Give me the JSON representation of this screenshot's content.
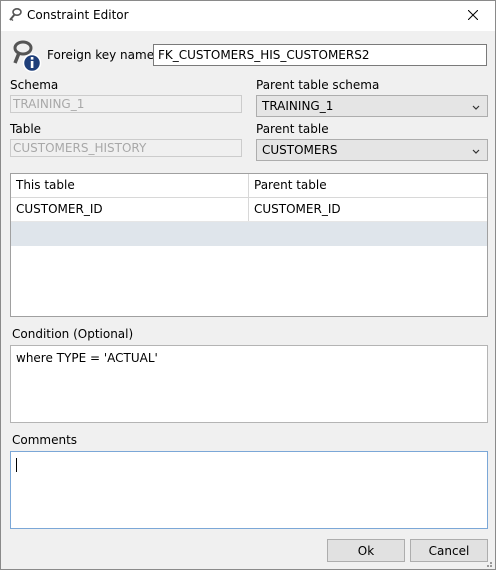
{
  "window": {
    "title": "Constraint Editor"
  },
  "header": {
    "fk_name_label": "Foreign key name",
    "fk_name_value": "FK_CUSTOMERS_HIS_CUSTOMERS2"
  },
  "left": {
    "schema_label": "Schema",
    "schema_value": "TRAINING_1",
    "table_label": "Table",
    "table_value": "CUSTOMERS_HISTORY"
  },
  "right": {
    "parent_schema_label": "Parent table schema",
    "parent_schema_value": "TRAINING_1",
    "parent_table_label": "Parent table",
    "parent_table_value": "CUSTOMERS"
  },
  "columns_grid": {
    "headers": [
      "This table",
      "Parent table"
    ],
    "rows": [
      [
        "CUSTOMER_ID",
        "CUSTOMER_ID"
      ],
      [
        "",
        ""
      ]
    ]
  },
  "condition": {
    "label": "Condition (Optional)",
    "value": "where TYPE = 'ACTUAL'"
  },
  "comments": {
    "label": "Comments",
    "value": ""
  },
  "buttons": {
    "ok": "Ok",
    "cancel": "Cancel"
  }
}
